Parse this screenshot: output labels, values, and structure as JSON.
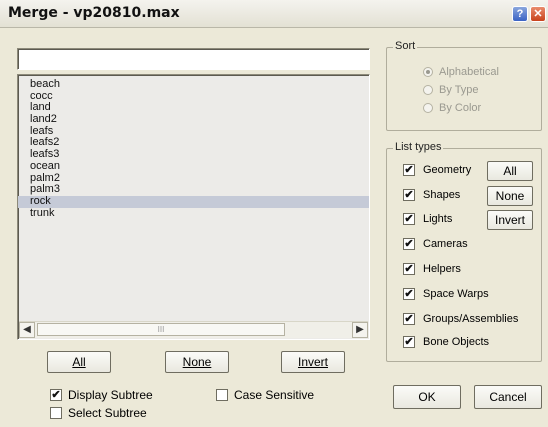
{
  "window": {
    "title": "Merge - vp20810.max",
    "help_glyph": "?",
    "close_glyph": "✕"
  },
  "filter": {
    "value": ""
  },
  "objects": [
    "beach",
    "cocc",
    "land",
    "land2",
    "leafs",
    "leafs2",
    "leafs3",
    "ocean",
    "palm2",
    "palm3",
    "rock",
    "trunk"
  ],
  "selected_index": 10,
  "scrollbar": {
    "left_glyph": "◀",
    "right_glyph": "▶",
    "thumb_grip": "III"
  },
  "select_buttons": {
    "all": "All",
    "none": "None",
    "invert": "Invert"
  },
  "options": {
    "display_subtree": {
      "label": "Display Subtree",
      "checked": true
    },
    "case_sensitive": {
      "label": "Case Sensitive",
      "checked": false
    },
    "select_subtree": {
      "label": "Select Subtree",
      "checked": false
    }
  },
  "sort": {
    "title": "Sort",
    "items": [
      {
        "label": "Alphabetical",
        "checked": true
      },
      {
        "label": "By Type",
        "checked": false
      },
      {
        "label": "By Color",
        "checked": false
      }
    ]
  },
  "list_types": {
    "title": "List types",
    "items": [
      {
        "label": "Geometry",
        "checked": true
      },
      {
        "label": "Shapes",
        "checked": true
      },
      {
        "label": "Lights",
        "checked": true
      },
      {
        "label": "Cameras",
        "checked": true
      },
      {
        "label": "Helpers",
        "checked": true
      },
      {
        "label": "Space Warps",
        "checked": true
      },
      {
        "label": "Groups/Assemblies",
        "checked": true
      },
      {
        "label": "Bone Objects",
        "checked": true
      }
    ],
    "all_label": "All",
    "none_label": "None",
    "invert_label": "Invert"
  },
  "dialog_buttons": {
    "ok": "OK",
    "cancel": "Cancel"
  },
  "check_glyph": "✔"
}
